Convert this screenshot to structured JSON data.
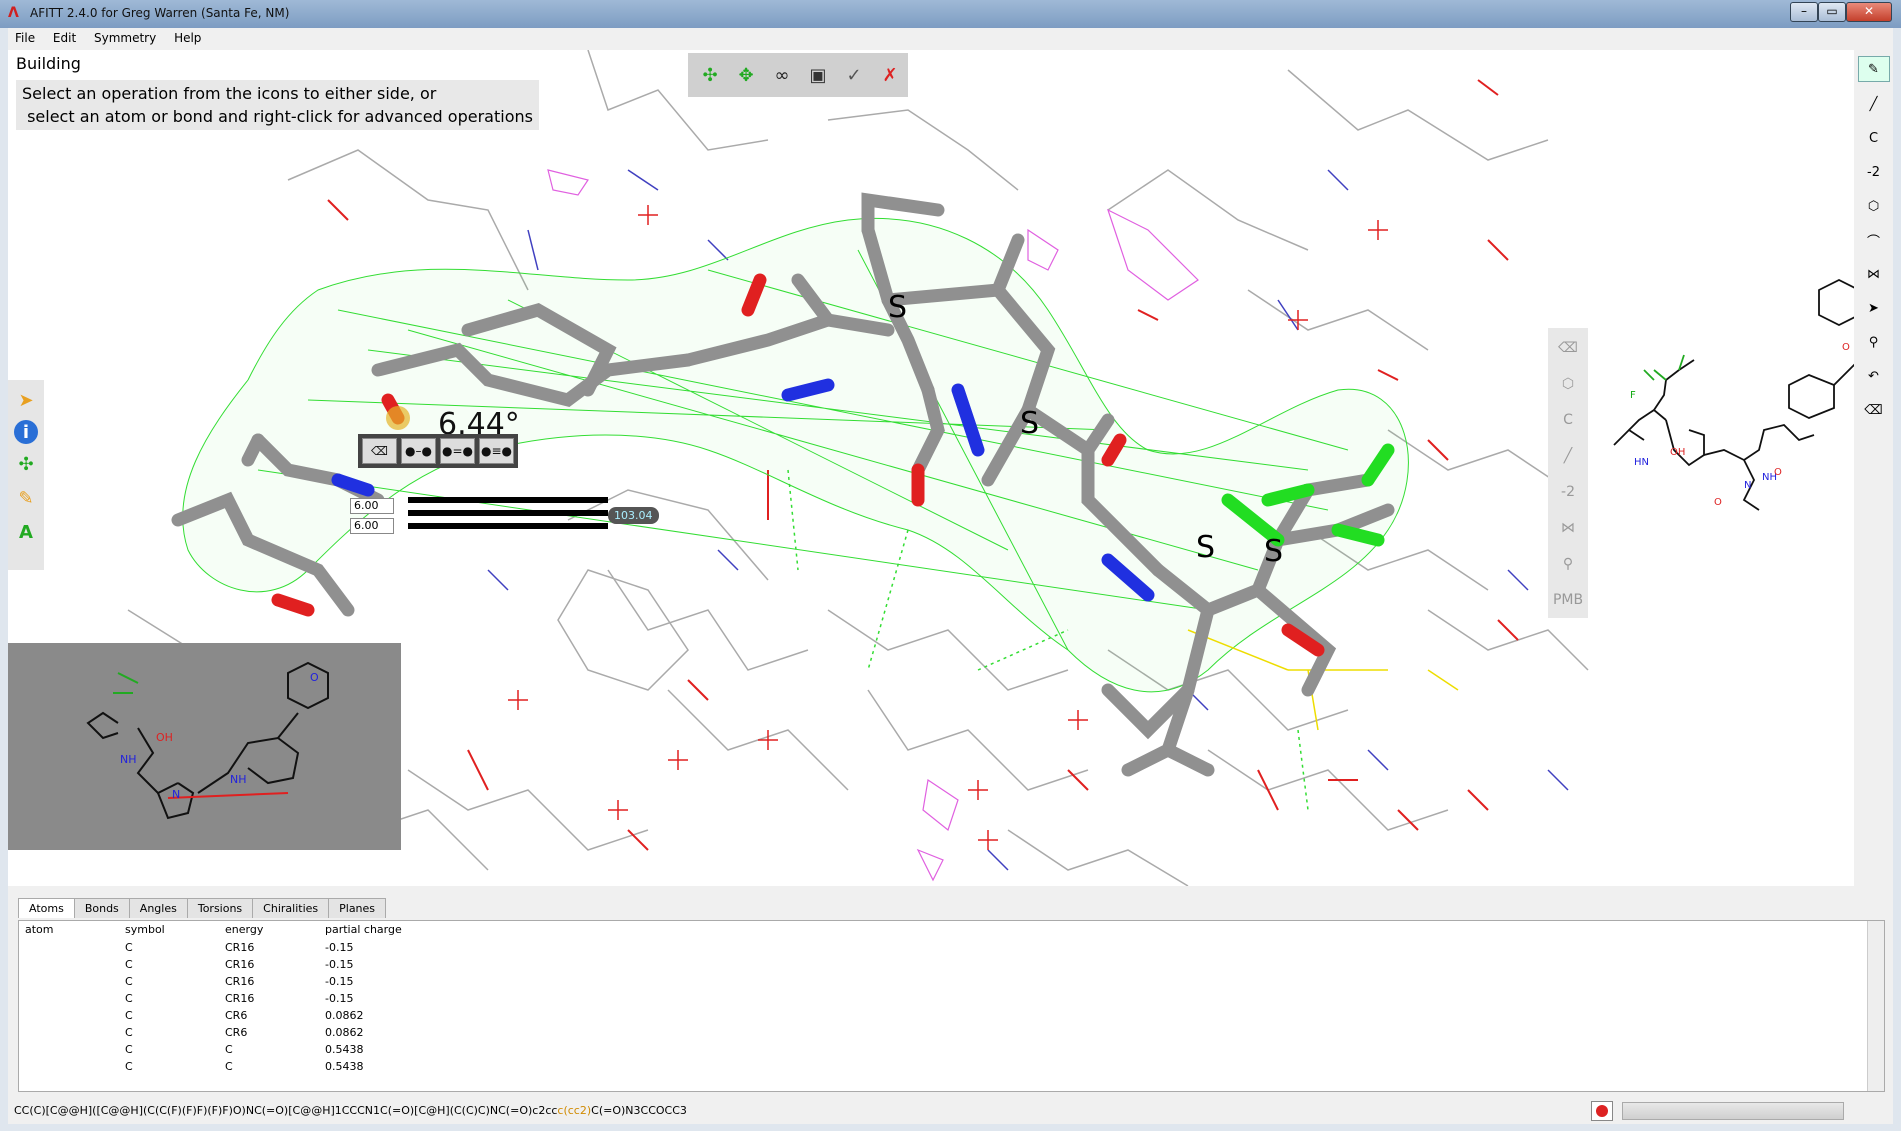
{
  "window": {
    "title": "AFITT 2.4.0 for Greg Warren (Santa Fe, NM)",
    "controls": [
      "–",
      "▭",
      "✕"
    ]
  },
  "menu": [
    "File",
    "Edit",
    "Symmetry",
    "Help"
  ],
  "viewport": {
    "mode": "Building",
    "hint_line1": "Select an operation from the icons to either side, or",
    "hint_line2": " select an atom or bond and right-click for advanced operations",
    "angle_readout": "6.44°",
    "spin1": "6.00",
    "spin2": "6.00",
    "slider_value": "103.04",
    "atom_labels": [
      "S",
      "S",
      "S",
      "S"
    ],
    "inset_labels": {
      "oh": "OH",
      "nh1": "NH",
      "nh2": "NH",
      "n": "N",
      "o": "O"
    }
  },
  "preview_labels": {
    "oh": "OH",
    "nh1": "HN",
    "nh2": "NH",
    "n": "N",
    "o1": "O",
    "o2": "O",
    "o3": "O",
    "f": "F"
  },
  "righttools": [
    "C",
    "-2",
    "PMB"
  ],
  "sidetools": [
    "C",
    "-2"
  ],
  "panel": {
    "tabs": [
      "Atoms",
      "Bonds",
      "Angles",
      "Torsions",
      "Chiralities",
      "Planes"
    ],
    "columns": [
      "atom",
      "symbol",
      "energy",
      "partial charge"
    ],
    "rows": [
      {
        "atom": "",
        "symbol": "C",
        "energy": "CR16",
        "charge": "-0.15"
      },
      {
        "atom": "",
        "symbol": "C",
        "energy": "CR16",
        "charge": "-0.15"
      },
      {
        "atom": "",
        "symbol": "C",
        "energy": "CR16",
        "charge": "-0.15"
      },
      {
        "atom": "",
        "symbol": "C",
        "energy": "CR16",
        "charge": "-0.15"
      },
      {
        "atom": "",
        "symbol": "C",
        "energy": "CR6",
        "charge": "0.0862"
      },
      {
        "atom": "",
        "symbol": "C",
        "energy": "CR6",
        "charge": "0.0862"
      },
      {
        "atom": "",
        "symbol": "C",
        "energy": "C",
        "charge": "0.5438"
      },
      {
        "atom": "",
        "symbol": "C",
        "energy": "C",
        "charge": "0.5438"
      }
    ]
  },
  "status": {
    "smiles_pre": "CC(C)[C@@H]([C@@H](C(C(F)(F)F)(F)F)O)NC(=O)[C@@H]1CCCN1C(=O)[C@H](C(C)C)NC(=O)c2cc",
    "smiles_hl": "c(cc2)",
    "smiles_post": "C(=O)N3CCOCC3"
  }
}
